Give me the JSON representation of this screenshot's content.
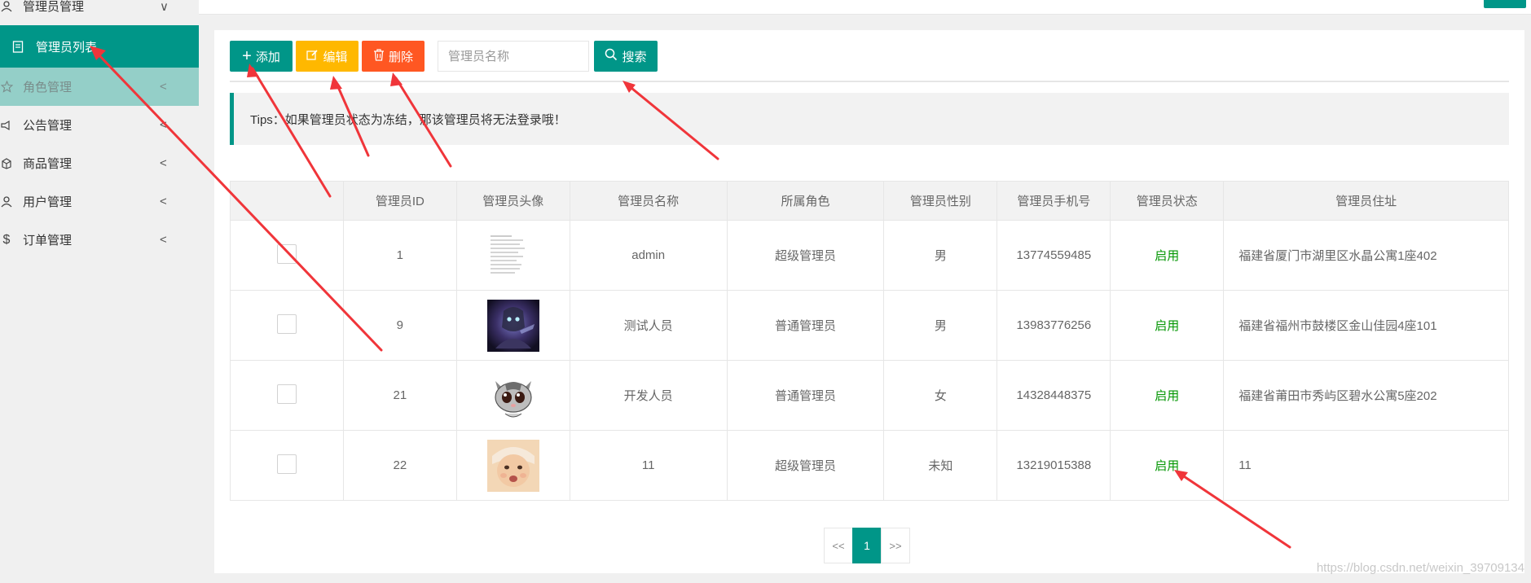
{
  "sidebar": {
    "items": [
      {
        "label": "管理员管理",
        "icon": "admin-icon",
        "chevron": "∨"
      },
      {
        "label": "管理员列表",
        "icon": "list-icon"
      },
      {
        "label": "角色管理",
        "icon": "star-icon",
        "chevron": "<"
      },
      {
        "label": "公告管理",
        "icon": "announcement-icon",
        "chevron": "<"
      },
      {
        "label": "商品管理",
        "icon": "goods-icon",
        "chevron": "<"
      },
      {
        "label": "用户管理",
        "icon": "user-icon",
        "chevron": "<"
      },
      {
        "label": "订单管理",
        "icon": "dollar-icon",
        "chevron": "<"
      }
    ]
  },
  "toolbar": {
    "add_label": "添加",
    "edit_label": "编辑",
    "delete_label": "删除",
    "search_placeholder": "管理员名称",
    "search_label": "搜索"
  },
  "tips": "Tips：如果管理员状态为冻结，那该管理员将无法登录哦！",
  "table": {
    "headers": [
      "",
      "管理员ID",
      "管理员头像",
      "管理员名称",
      "所属角色",
      "管理员性别",
      "管理员手机号",
      "管理员状态",
      "管理员住址"
    ],
    "rows": [
      {
        "id": "1",
        "avatar": "document-thumbnail",
        "name": "admin",
        "role": "超级管理员",
        "gender": "男",
        "phone": "13774559485",
        "status": "启用",
        "address": "福建省厦门市湖里区水晶公寓1座402"
      },
      {
        "id": "9",
        "avatar": "game-character-thumbnail",
        "name": "测试人员",
        "role": "普通管理员",
        "gender": "男",
        "phone": "13983776256",
        "status": "启用",
        "address": "福建省福州市鼓楼区金山佳园4座101"
      },
      {
        "id": "21",
        "avatar": "cartoon-cat-thumbnail",
        "name": "开发人员",
        "role": "普通管理员",
        "gender": "女",
        "phone": "14328448375",
        "status": "启用",
        "address": "福建省莆田市秀屿区碧水公寓5座202"
      },
      {
        "id": "22",
        "avatar": "baby-photo-thumbnail",
        "name": "11",
        "role": "超级管理员",
        "gender": "未知",
        "phone": "13219015388",
        "status": "启用",
        "address": "11"
      }
    ]
  },
  "pagination": {
    "prev": "<<",
    "current": "1",
    "next": ">>"
  },
  "watermark": "https://blog.csdn.net/weixin_39709134",
  "colors": {
    "primary": "#009688",
    "warning": "#ffb800",
    "danger": "#ff5722",
    "status": "#009600",
    "arrow": "#f0353a"
  }
}
